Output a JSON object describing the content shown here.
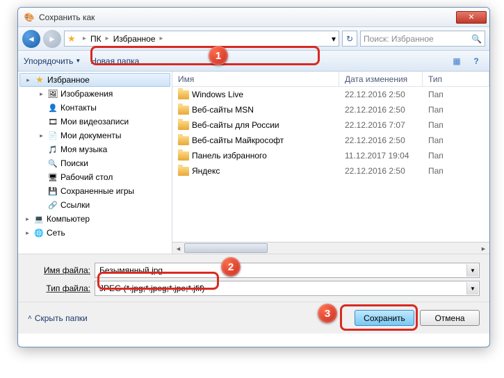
{
  "title": "Сохранить как",
  "breadcrumb": {
    "root": "ПК",
    "current": "Избранное"
  },
  "search_placeholder": "Поиск: Избранное",
  "toolbar": {
    "organize": "Упорядочить",
    "new_folder": "Новая папка"
  },
  "tree": [
    {
      "label": "Избранное",
      "icon": "star-ico",
      "selected": true,
      "indent": 1,
      "toggle": "▸"
    },
    {
      "label": "Изображения",
      "icon": "img-ico",
      "indent": 1,
      "toggle": "▸"
    },
    {
      "label": "Контакты",
      "icon": "contact-ico",
      "indent": 1,
      "toggle": ""
    },
    {
      "label": "Мои видеозаписи",
      "icon": "video-ico",
      "indent": 1,
      "toggle": ""
    },
    {
      "label": "Мои документы",
      "icon": "doc-ico",
      "indent": 1,
      "toggle": "▸"
    },
    {
      "label": "Моя музыка",
      "icon": "music-ico",
      "indent": 1,
      "toggle": ""
    },
    {
      "label": "Поиски",
      "icon": "search-ico",
      "indent": 1,
      "toggle": ""
    },
    {
      "label": "Рабочий стол",
      "icon": "desk-ico",
      "indent": 1,
      "toggle": ""
    },
    {
      "label": "Сохраненные игры",
      "icon": "game-ico",
      "indent": 1,
      "toggle": ""
    },
    {
      "label": "Ссылки",
      "icon": "link-ico",
      "indent": 1,
      "toggle": ""
    },
    {
      "label": "Компьютер",
      "icon": "comp-ico",
      "indent": 0,
      "toggle": "▸"
    },
    {
      "label": "Сеть",
      "icon": "net-ico",
      "indent": 0,
      "toggle": "▸"
    }
  ],
  "columns": {
    "name": "Имя",
    "date": "Дата изменения",
    "type": "Тип"
  },
  "rows": [
    {
      "name": "Windows Live",
      "date": "22.12.2016 2:50",
      "type": "Пап"
    },
    {
      "name": "Веб-сайты MSN",
      "date": "22.12.2016 2:50",
      "type": "Пап"
    },
    {
      "name": "Веб-сайты для России",
      "date": "22.12.2016 7:07",
      "type": "Пап"
    },
    {
      "name": "Веб-сайты Майкрософт",
      "date": "22.12.2016 2:50",
      "type": "Пап"
    },
    {
      "name": "Панель избранного",
      "date": "11.12.2017 19:04",
      "type": "Пап"
    },
    {
      "name": "Яндекс",
      "date": "22.12.2016 2:50",
      "type": "Пап"
    }
  ],
  "filename_label": "Имя файла:",
  "filename_value": "Безымянный.jpg",
  "filetype_label": "Тип файла:",
  "filetype_value": "JPEG (*.jpg;*.jpeg;*.jpe;*.jfif)",
  "hide_folders": "Скрыть папки",
  "save_label": "Сохранить",
  "cancel_label": "Отмена",
  "markers": {
    "m1": "1",
    "m2": "2",
    "m3": "3"
  }
}
